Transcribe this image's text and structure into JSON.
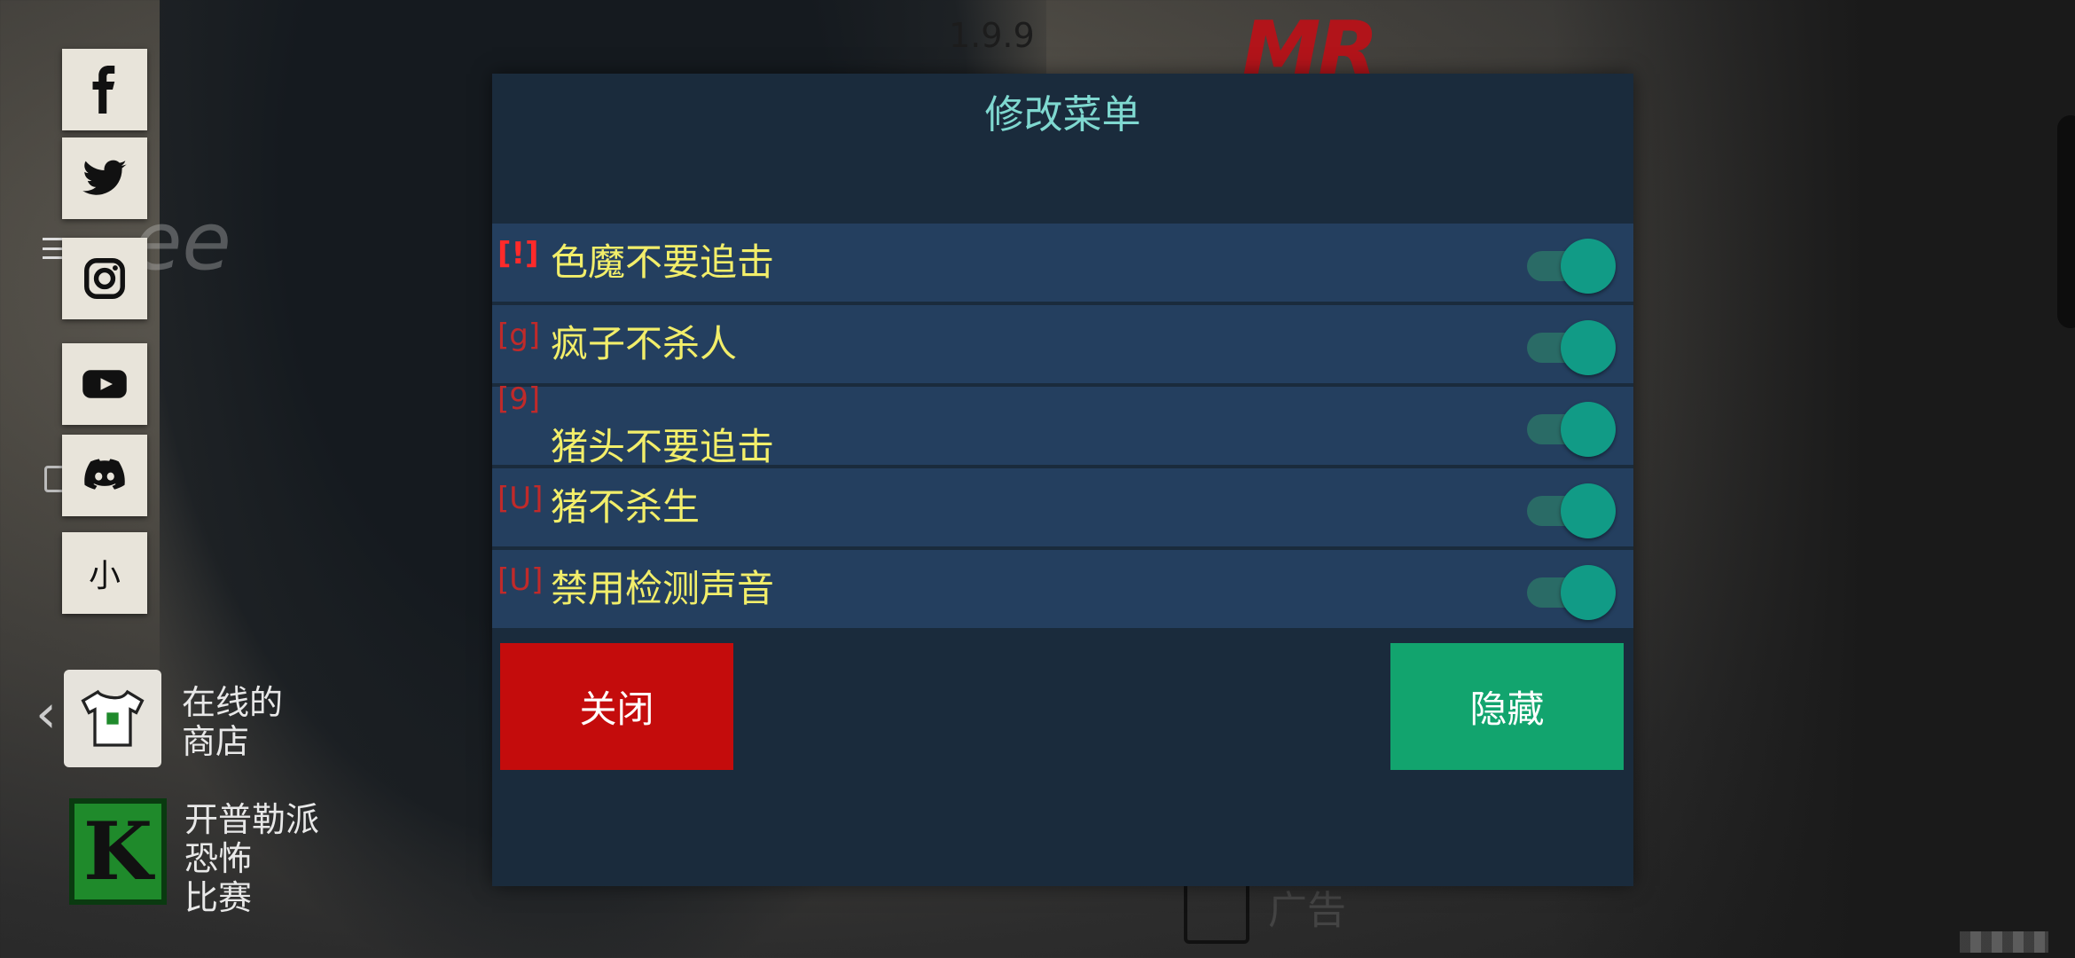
{
  "version": "1.9.9",
  "brand_logo": "MR",
  "social_icons": [
    {
      "name": "facebook-icon"
    },
    {
      "name": "twitter-icon"
    },
    {
      "name": "instagram-icon"
    },
    {
      "name": "youtube-icon"
    },
    {
      "name": "discord-icon"
    },
    {
      "name": "small-icon",
      "label": "小"
    }
  ],
  "left_menu": {
    "store_label_line1": "在线的",
    "store_label_line2": "商店",
    "contest_line1": "开普勒派",
    "contest_line2": "恐怖",
    "contest_line3": "比赛",
    "contest_icon_letter": "K"
  },
  "ad_label": "广告",
  "mod_menu": {
    "title": "修改菜单",
    "items": [
      {
        "icon": "[!]",
        "label": "色魔不要追击",
        "enabled": true
      },
      {
        "icon": "[g]",
        "label": "疯子不杀人",
        "enabled": true
      },
      {
        "icon": "[9]",
        "label": "猪头不要追击",
        "enabled": true
      },
      {
        "icon": "[U]",
        "label": "猪不杀生",
        "enabled": true
      },
      {
        "icon": "[U]",
        "label": "禁用检测声音",
        "enabled": true
      }
    ],
    "close_label": "关闭",
    "hide_label": "隐藏"
  },
  "colors": {
    "dialog_bg": "#1a2b3c",
    "row_bg": "#243f5f",
    "title": "#7fd8d0",
    "label": "#f2ee6a",
    "toggle_on": "#119b86",
    "close_button": "#c40c0c",
    "hide_button": "#12a46e"
  }
}
